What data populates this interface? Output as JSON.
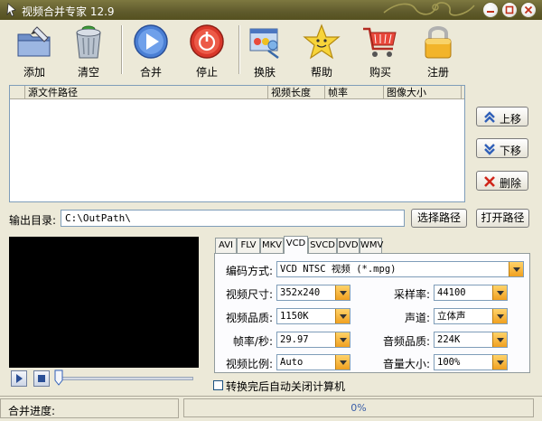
{
  "window": {
    "title": "视频合并专家 12.9"
  },
  "toolbar": {
    "add": "添加",
    "clear": "清空",
    "merge": "合并",
    "stop": "停止",
    "skin": "换肤",
    "help": "帮助",
    "buy": "购买",
    "register": "注册"
  },
  "filelist": {
    "columns": [
      "源文件路径",
      "视频长度",
      "帧率",
      "图像大小"
    ],
    "rows": []
  },
  "side": {
    "up": "上移",
    "down": "下移",
    "delete": "删除"
  },
  "output": {
    "label": "输出目录:",
    "path": "C:\\OutPath\\",
    "choose": "选择路径",
    "open": "打开路径"
  },
  "tabs": [
    "AVI",
    "FLV",
    "MKV",
    "VCD",
    "SVCD",
    "DVD",
    "WMV"
  ],
  "active_tab": "VCD",
  "settings": {
    "encode_label": "编码方式:",
    "encode": "VCD NTSC 视频 (*.mpg)",
    "size_label": "视频尺寸:",
    "size": "352x240",
    "quality_label": "视频品质:",
    "quality": "1150K",
    "fps_label": "帧率/秒:",
    "fps": "29.97",
    "ratio_label": "视频比例:",
    "ratio": "Auto",
    "samplerate_label": "采样率:",
    "samplerate": "44100",
    "channel_label": "声道:",
    "channel": "立体声",
    "audioq_label": "音频品质:",
    "audioq": "224K",
    "volume_label": "音量大小:",
    "volume": "100%"
  },
  "shutdown": {
    "label": "转换完后自动关闭计算机",
    "checked": false
  },
  "status": {
    "label": "合并进度:",
    "progress_text": "0%",
    "progress": 0
  },
  "player": {
    "seek": 0
  },
  "colors": {
    "title_bar": "#5f5a2c",
    "accent": "#f0a020",
    "face": "#ECE9D8"
  }
}
